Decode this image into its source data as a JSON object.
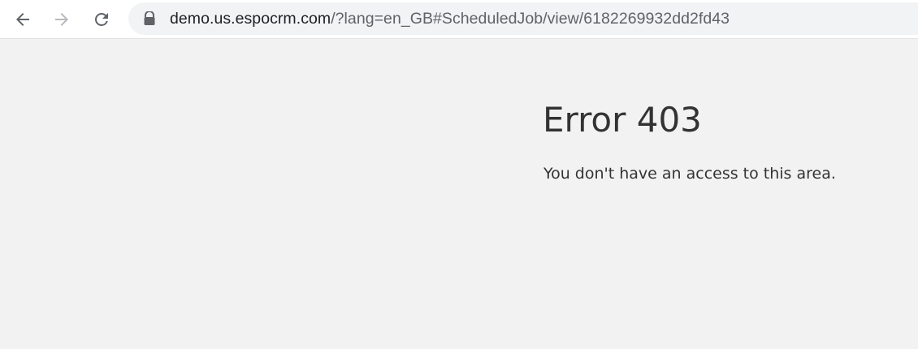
{
  "browser": {
    "url_host": "demo.us.espocrm.com",
    "url_rest": "/?lang=en_GB#ScheduledJob/view/6182269932dd2fd43",
    "icons": {
      "back": "arrow-left-icon",
      "forward": "arrow-right-icon",
      "reload": "reload-icon",
      "lock": "lock-icon"
    },
    "colors": {
      "icon_active": "#5f6368",
      "icon_disabled": "#b8babd",
      "omnibox_bg": "#f1f3f4"
    }
  },
  "page": {
    "error_title": "Error 403",
    "error_message": "You don't have an access to this area.",
    "colors": {
      "background": "#f2f2f2",
      "text": "#333333"
    }
  }
}
